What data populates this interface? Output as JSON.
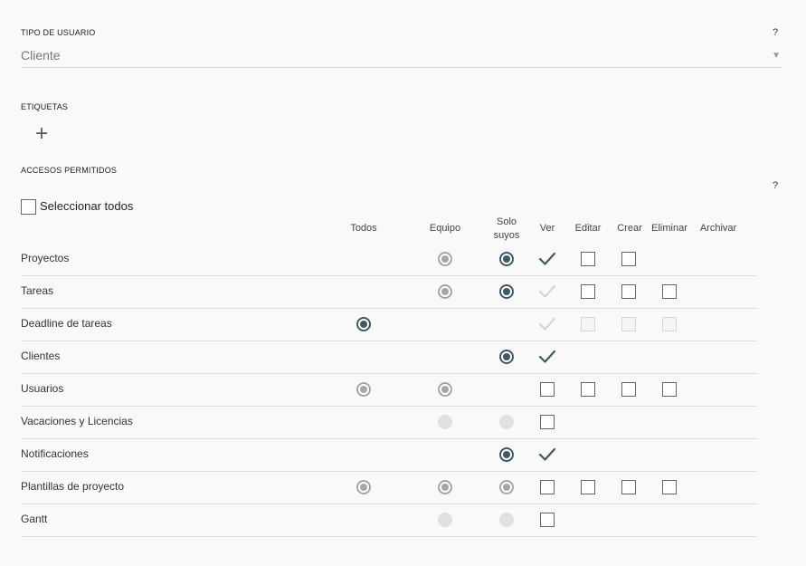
{
  "user_type": {
    "label": "TIPO DE USUARIO",
    "help": "?",
    "value": "Cliente",
    "arrow": "▼"
  },
  "tags": {
    "label": "ETIQUETAS",
    "add": "+"
  },
  "access": {
    "label": "ACCESOS PERMITIDOS",
    "help": "?",
    "select_all": "Seleccionar todos",
    "columns": {
      "todos": "Todos",
      "equipo": "Equipo",
      "solo_1": "Solo",
      "solo_2": "suyos",
      "ver": "Ver",
      "editar": "Editar",
      "crear": "Crear",
      "eliminar": "Eliminar",
      "archivar": "Archivar"
    },
    "rows": [
      {
        "label": "Proyectos",
        "todos": null,
        "equipo": "grey",
        "solo": "on",
        "ver": "check",
        "editar": "box",
        "crear": "box",
        "eliminar": null
      },
      {
        "label": "Tareas",
        "todos": null,
        "equipo": "grey",
        "solo": "on",
        "ver": "check-faint",
        "editar": "box",
        "crear": "box",
        "eliminar": "box"
      },
      {
        "label": "Deadline de tareas",
        "todos": "on",
        "equipo": null,
        "solo": null,
        "ver": "check-faint",
        "editar": "box-faint",
        "crear": "box-faint",
        "eliminar": "box-faint"
      },
      {
        "label": "Clientes",
        "todos": null,
        "equipo": null,
        "solo": "on",
        "ver": "check",
        "editar": null,
        "crear": null,
        "eliminar": null
      },
      {
        "label": "Usuarios",
        "todos": "grey",
        "equipo": "grey",
        "solo": null,
        "ver": "box",
        "editar": "box",
        "crear": "box",
        "eliminar": "box"
      },
      {
        "label": "Vacaciones y Licencias",
        "todos": null,
        "equipo": "faint",
        "solo": "faint",
        "ver": "box",
        "editar": null,
        "crear": null,
        "eliminar": null
      },
      {
        "label": "Notificaciones",
        "todos": null,
        "equipo": null,
        "solo": "on",
        "ver": "check",
        "editar": null,
        "crear": null,
        "eliminar": null
      },
      {
        "label": "Plantillas de proyecto",
        "todos": "grey",
        "equipo": "grey",
        "solo": "grey",
        "ver": "box",
        "editar": "box",
        "crear": "box",
        "eliminar": "box"
      },
      {
        "label": "Gantt",
        "todos": null,
        "equipo": "faint",
        "solo": "faint",
        "ver": "box",
        "editar": null,
        "crear": null,
        "eliminar": null
      }
    ]
  },
  "colors": {
    "accent": "#3d5a66",
    "radio_grey": "#a6a6a6",
    "check_faint": "#d4d4d4"
  }
}
